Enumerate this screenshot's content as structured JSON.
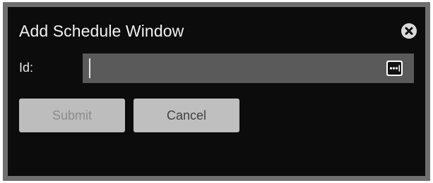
{
  "dialog": {
    "title": "Add Schedule Window",
    "close_icon": "close-circle-icon"
  },
  "form": {
    "id_label": "Id:",
    "id_value": "",
    "autofill_icon": "password-manager-dots-icon"
  },
  "actions": {
    "submit_label": "Submit",
    "submit_disabled": true,
    "cancel_label": "Cancel"
  },
  "colors": {
    "dialog_background": "#0c0c0c",
    "dialog_border": "#6f6f6f",
    "input_background": "#5a5a5a",
    "button_background": "#bfbfbf"
  }
}
